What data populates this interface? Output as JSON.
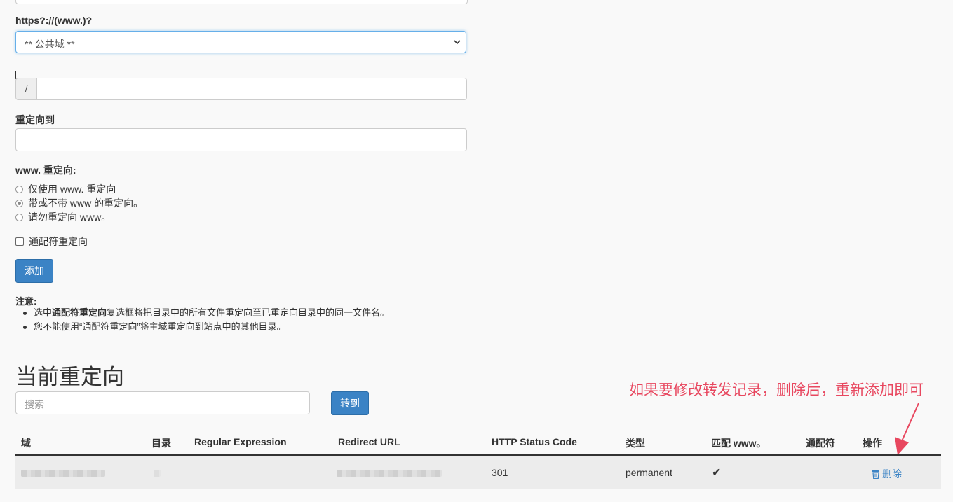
{
  "form": {
    "protocol_label": "https?://(www.)?",
    "domain_select_value": "** 公共域 **",
    "path_prefix": "/",
    "redirect_to_label": "重定向到",
    "www_redirect_label": "www. 重定向:",
    "radio_options": [
      "仅使用 www. 重定向",
      "带或不带 www 的重定向。",
      "请勿重定向 www。"
    ],
    "radio_selected_index": 1,
    "wildcard_label": "通配符重定向",
    "add_button": "添加"
  },
  "notes": {
    "title": "注意:",
    "item1_prefix": "选中",
    "item1_bold": "通配符重定向",
    "item1_suffix": "复选框将把目录中的所有文件重定向至已重定向目录中的同一文件名。",
    "item2": "您不能使用“通配符重定向”将主域重定向到站点中的其他目录。"
  },
  "current": {
    "heading": "当前重定向",
    "search_placeholder": "搜索",
    "go_button": "转到",
    "annotation": "如果要修改转发记录，删除后，重新添加即可",
    "columns": [
      "域",
      "目录",
      "Regular Expression",
      "Redirect URL",
      "HTTP Status Code",
      "类型",
      "匹配 www。",
      "通配符",
      "操作"
    ],
    "row": {
      "status_code": "301",
      "type": "permanent",
      "match_www_mark": "✔",
      "delete_label": "删除"
    }
  },
  "icons": {
    "select_chevron": "chevron-down-icon",
    "delete": "trash-icon",
    "check": "check-icon",
    "annotation_arrow": "arrow-icon"
  },
  "colors": {
    "primary": "#3b83c5",
    "annotation": "#e8475f"
  }
}
